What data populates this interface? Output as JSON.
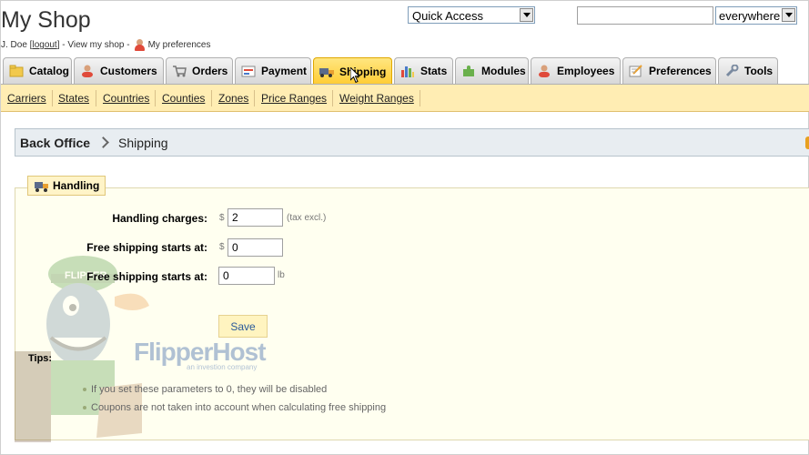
{
  "header": {
    "shop_title": "My Shop",
    "user_prefix": "J. Doe [",
    "logout_label": "logout",
    "user_mid": "] - View my shop -",
    "preferences_label": "My preferences",
    "quick_access": "Quick Access",
    "search_value": "",
    "search_scope": "everywhere"
  },
  "tabs": [
    {
      "label": "Catalog",
      "icon": "folder-icon"
    },
    {
      "label": "Customers",
      "icon": "customers-icon"
    },
    {
      "label": "Orders",
      "icon": "cart-icon"
    },
    {
      "label": "Payment",
      "icon": "payment-icon"
    },
    {
      "label": "Shipping",
      "icon": "truck-icon",
      "active": true
    },
    {
      "label": "Stats",
      "icon": "stats-icon"
    },
    {
      "label": "Modules",
      "icon": "puzzle-icon"
    },
    {
      "label": "Employees",
      "icon": "employees-icon"
    },
    {
      "label": "Preferences",
      "icon": "preferences-icon"
    },
    {
      "label": "Tools",
      "icon": "wrench-icon"
    }
  ],
  "subnav": [
    "Carriers",
    "States",
    "Countries",
    "Counties",
    "Zones",
    "Price Ranges",
    "Weight Ranges"
  ],
  "breadcrumb": {
    "root": "Back Office",
    "current": "Shipping"
  },
  "handling": {
    "legend": "Handling",
    "fields": [
      {
        "label": "Handling charges:",
        "prefix": "$",
        "value": "2",
        "suffix": "(tax excl.)"
      },
      {
        "label": "Free shipping starts at:",
        "prefix": "$",
        "value": "0",
        "suffix": ""
      },
      {
        "label": "Free shipping starts at:",
        "prefix": "",
        "value": "0",
        "suffix": "lb"
      }
    ],
    "save_label": "Save",
    "tips_label": "Tips:",
    "tips": [
      "If you set these parameters to 0, they will be disabled",
      "Coupons are not taken into account when calculating free shipping"
    ]
  },
  "watermark": {
    "main": "FlipperHost",
    "sub": "an investion company",
    "cap_text": "FLIPPER"
  },
  "colors": {
    "active_tab": "#ffcc33",
    "subnav_bg": "#ffedb3",
    "panel_bg": "#fffff0",
    "breadcrumb_bg": "#e8edf1"
  }
}
